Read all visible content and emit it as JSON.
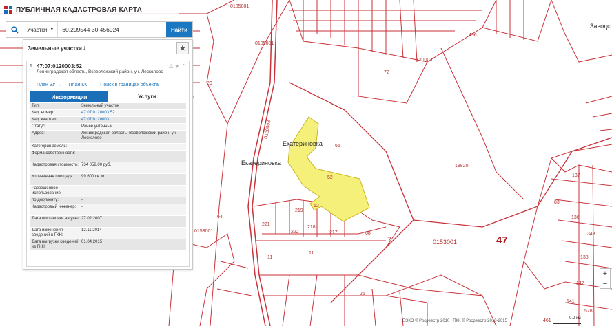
{
  "header": {
    "title": "ПУБЛИЧНАЯ КАДАСТРОВАЯ КАРТА"
  },
  "search": {
    "type_label": "Участки",
    "value": "60,299544 30,456924",
    "button_label": "Найти"
  },
  "panel": {
    "title": "Земельные участки",
    "count": "1",
    "result": {
      "number": "1.",
      "cad_number": "47:07:0120003:52",
      "address": "Ленинградская область, Всеволожский район, уч. Лесколово",
      "links": [
        "План ЗУ →",
        "План КК →",
        "Поиск в границах объекта →"
      ]
    },
    "tabs": [
      "Информация",
      "Услуги"
    ],
    "properties": [
      {
        "label": "Тип:",
        "value": "Земельный участок"
      },
      {
        "label": "Кад. номер:",
        "value": "47:07:0120003:52"
      },
      {
        "label": "Кад. квартал:",
        "value": "47:07:0120003"
      },
      {
        "label": "Статус:",
        "value": "Ранее учтенный"
      },
      {
        "label": "Адрес:",
        "value": "Ленинградская область, Всеволожский район, уч. Лесколово"
      },
      {
        "label": "Категория земель:",
        "value": ""
      },
      {
        "label": "Форма собственности:",
        "value": "-"
      },
      {
        "label": "Кадастровая стоимость:",
        "value": "734 052,00 руб."
      },
      {
        "label": "Уточненная площадь:",
        "value": "99 600 кв. м"
      },
      {
        "label": "Разрешенное использование:",
        "value": "-"
      },
      {
        "label": "по документу:",
        "value": "-"
      },
      {
        "label": "Кадастровый инженер:",
        "value": "-"
      },
      {
        "label": "Дата постановки на учет:",
        "value": "27.02.2007"
      },
      {
        "label": "Дата изменения сведений в ГКН:",
        "value": "12.11.2014"
      },
      {
        "label": "Дата выгрузки сведений из ГКН:",
        "value": "01.04.2015"
      }
    ]
  },
  "map": {
    "places": [
      "Екатериновка",
      "Екатериновка",
      "Заводс"
    ],
    "kvartal_big": "47",
    "kvartal_numbers": [
      "0105001",
      "0105001",
      "0120003",
      "0120003",
      "0153001",
      "0153001"
    ],
    "parcel_numbers": [
      "496",
      "72",
      "20",
      "66",
      "52",
      "62",
      "219",
      "221",
      "222",
      "217",
      "218",
      "68",
      "7",
      "64",
      "11",
      "11",
      "25",
      "18820",
      "137",
      "83",
      "136",
      "343",
      "138",
      "142",
      "141",
      "578",
      "461"
    ],
    "accent_color": "#c0252b",
    "highlight_color": "#f5f07a"
  },
  "controls": {
    "zoom_in": "+",
    "zoom_out": "−",
    "scale_label": "0.2 км"
  },
  "footer": {
    "copyright": "ЕЭКО © Росреестр 2010 | ПКК © Росреестр 2010-2015"
  }
}
